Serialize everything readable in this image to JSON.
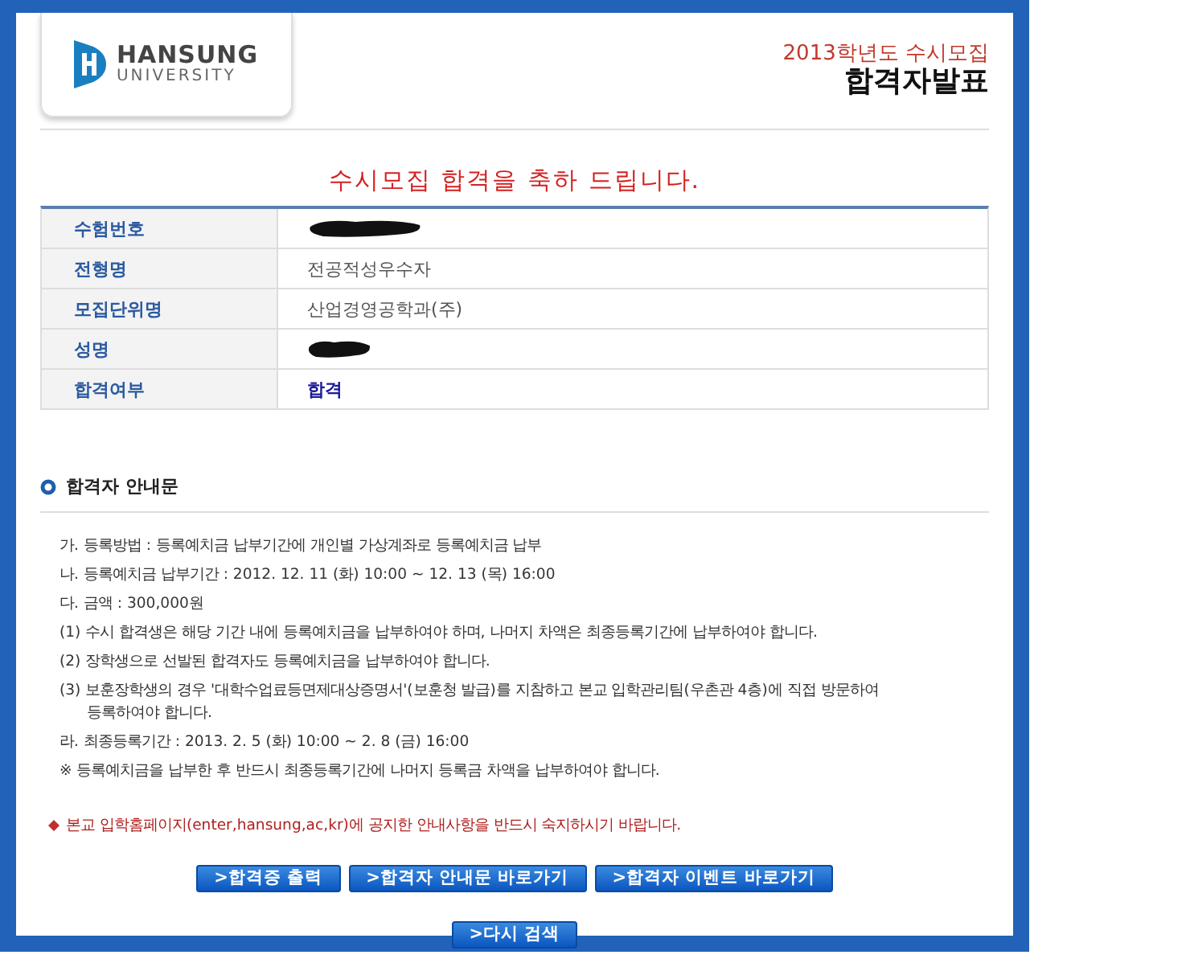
{
  "header": {
    "logo": {
      "name": "HANSUNG",
      "sub": "UNIVERSITY"
    },
    "subtitle": "2013학년도 수시모집",
    "title": "합격자발표"
  },
  "congrats": "수시모집 합격을 축하 드립니다.",
  "result_table": [
    {
      "label": "수험번호",
      "redacted": true
    },
    {
      "label": "전형명",
      "value": "전공적성우수자",
      "emphasis": false
    },
    {
      "label": "모집단위명",
      "value": "산업경영공학과(주)",
      "emphasis": false
    },
    {
      "label": "성명",
      "redacted": true
    },
    {
      "label": "합격여부",
      "value": "합격",
      "emphasis": true
    }
  ],
  "guide": {
    "heading": "합격자 안내문",
    "lines": [
      {
        "text": "가. 등록방법 : 등록예치금 납부기간에 개인별 가상계좌로 등록예치금 납부"
      },
      {
        "text": "나. 등록예치금 납부기간 : 2012. 12. 11 (화) 10:00 ~ 12. 13 (목) 16:00"
      },
      {
        "text": "다. 금액 : 300,000원"
      },
      {
        "text": "(1) 수시 합격생은 해당 기간 내에 등록예치금을 납부하여야 하며, 나머지 차액은 최종등록기간에 납부하여야 합니다."
      },
      {
        "text": "(2) 장학생으로 선발된 합격자도 등록예치금을 납부하여야 합니다."
      },
      {
        "text": "(3) 보훈장학생의 경우 '대학수업료등면제대상증명서'(보훈청 발급)를 지참하고 본교 입학관리팀(우촌관 4층)에 직접 방문하여",
        "continuation": "등록하여야 합니다."
      },
      {
        "text": "라. 최종등록기간 : 2013. 2. 5 (화) 10:00 ~ 2. 8 (금) 16:00"
      },
      {
        "text": "※ 등록예치금을 납부한 후 반드시 최종등록기간에 나머지 등록금 차액을 납부하여야 합니다."
      }
    ],
    "notice": "본교 입학홈페이지(enter,hansung,ac,kr)에 공지한 안내사항을 반드시 숙지하시기 바랍니다."
  },
  "buttons": [
    ">합격증 출력",
    ">합격자 안내문 바로가기",
    ">합격자 이벤트 바로가기"
  ],
  "search_button": ">다시 검색"
}
